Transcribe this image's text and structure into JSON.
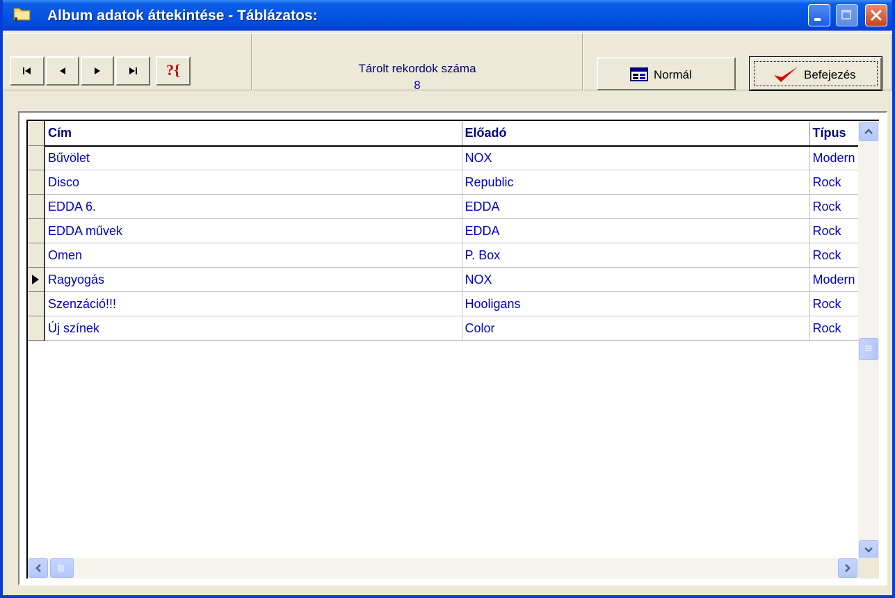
{
  "window": {
    "title": "Album adatok áttekintése - Táblázatos:",
    "colors": {
      "titlebar": "#0554e3",
      "grid_text": "#0000c0",
      "header_text": "#000080",
      "close": "#c8421b"
    }
  },
  "toolbar": {
    "nav_buttons": [
      "first-record",
      "previous-record",
      "next-record",
      "last-record"
    ],
    "help_label": "?{",
    "counter_label": "Tárolt rekordok száma",
    "counter_value": "8",
    "normal_label": "Normál",
    "finish_label": "Befejezés"
  },
  "grid": {
    "columns": [
      "Cím",
      "Előadó",
      "Típus"
    ],
    "current_row": 5,
    "rows": [
      [
        "Bűvölet",
        "NOX",
        "Modern"
      ],
      [
        "Disco",
        "Republic",
        "Rock"
      ],
      [
        "EDDA 6.",
        "EDDA",
        "Rock"
      ],
      [
        "EDDA művek",
        "EDDA",
        "Rock"
      ],
      [
        "Omen",
        "P. Box",
        "Rock"
      ],
      [
        "Ragyogás",
        "NOX",
        "Modern"
      ],
      [
        "Szenzáció!!!",
        "Hooligans",
        "Rock"
      ],
      [
        "Új színek",
        "Color",
        "Rock"
      ]
    ]
  }
}
